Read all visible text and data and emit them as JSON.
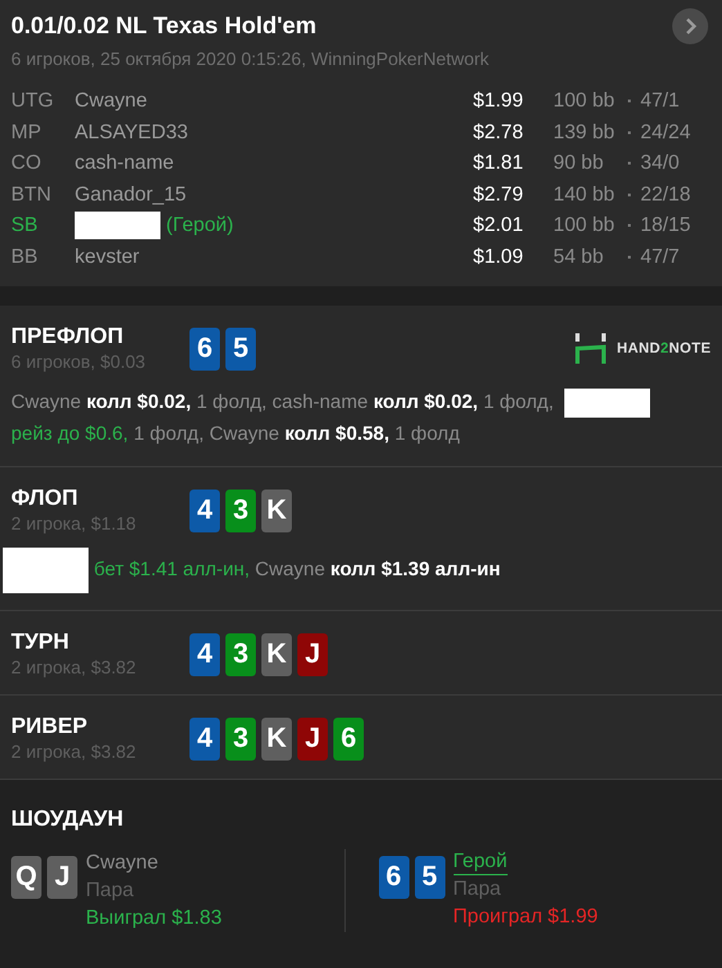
{
  "header": {
    "title": "0.01/0.02 NL Texas Hold'em",
    "subtitle": "6 игроков, 25 октября 2020 0:15:26, WinningPokerNetwork"
  },
  "players": [
    {
      "position": "UTG",
      "name": "Cwayne",
      "hero": false,
      "stack": "$1.99",
      "bb": "100 bb",
      "stats": "47/1"
    },
    {
      "position": "MP",
      "name": "ALSAYED33",
      "hero": false,
      "stack": "$2.78",
      "bb": "139 bb",
      "stats": "24/24"
    },
    {
      "position": "CO",
      "name": "cash-name",
      "hero": false,
      "stack": "$1.81",
      "bb": "90 bb",
      "stats": "34/0"
    },
    {
      "position": "BTN",
      "name": "Ganador_15",
      "hero": false,
      "stack": "$2.79",
      "bb": "140 bb",
      "stats": "22/18"
    },
    {
      "position": "SB",
      "name": "(Герой)",
      "hero": true,
      "stack": "$2.01",
      "bb": "100 bb",
      "stats": "18/15"
    },
    {
      "position": "BB",
      "name": "kevster",
      "hero": false,
      "stack": "$1.09",
      "bb": "54 bb",
      "stats": "47/7"
    }
  ],
  "streets": [
    {
      "title": "ПРЕФЛОП",
      "info": "6 игроков, $0.03",
      "logo": {
        "before": "HAND",
        "accent": "2",
        "after": "NOTE"
      },
      "cards": [
        {
          "rank": "6",
          "color": "#0d5aa8"
        },
        {
          "rank": "5",
          "color": "#0d5aa8"
        }
      ],
      "actions": [
        {
          "kind": "plain",
          "text": "Cwayne "
        },
        {
          "kind": "bold",
          "text": "колл $0.02,"
        },
        {
          "kind": "plain",
          "text": " 1 фолд, cash-name "
        },
        {
          "kind": "bold",
          "text": "колл $0.02,"
        },
        {
          "kind": "plain",
          "text": " 1 фолд, "
        },
        {
          "kind": "redacted"
        },
        {
          "kind": "break"
        },
        {
          "kind": "hero",
          "text": "рейз до $0.6,"
        },
        {
          "kind": "plain",
          "text": " 1 фолд, Cwayne "
        },
        {
          "kind": "bold",
          "text": "колл $0.58,"
        },
        {
          "kind": "plain",
          "text": " 1 фолд"
        }
      ]
    },
    {
      "title": "ФЛОП",
      "info": "2 игрока, $1.18",
      "cards": [
        {
          "rank": "4",
          "color": "#0d5aa8"
        },
        {
          "rank": "3",
          "color": "#088f1b"
        },
        {
          "rank": "K",
          "color": "#5f5f5f"
        }
      ],
      "actions": [
        {
          "kind": "redacted"
        },
        {
          "kind": "hero",
          "text": " бет $1.41 алл-ин,"
        },
        {
          "kind": "plain",
          "text": " Cwayne "
        },
        {
          "kind": "bold",
          "text": "колл $1.39 алл-ин"
        }
      ]
    },
    {
      "title": "ТУРН",
      "info": "2 игрока, $3.82",
      "cards": [
        {
          "rank": "4",
          "color": "#0d5aa8"
        },
        {
          "rank": "3",
          "color": "#088f1b"
        },
        {
          "rank": "K",
          "color": "#5f5f5f"
        },
        {
          "rank": "J",
          "color": "#8f0606"
        }
      ]
    },
    {
      "title": "РИВЕР",
      "info": "2 игрока, $3.82",
      "cards": [
        {
          "rank": "4",
          "color": "#0d5aa8"
        },
        {
          "rank": "3",
          "color": "#088f1b"
        },
        {
          "rank": "K",
          "color": "#5f5f5f"
        },
        {
          "rank": "J",
          "color": "#8f0606"
        },
        {
          "rank": "6",
          "color": "#088f1b"
        }
      ]
    }
  ],
  "showdown": {
    "title": "ШОУДАУН",
    "hands": [
      {
        "cards": [
          {
            "rank": "Q",
            "color": "#5f5f5f"
          },
          {
            "rank": "J",
            "color": "#5f5f5f"
          }
        ],
        "name": "Cwayne",
        "hero": false,
        "combo": "Пара",
        "result": "Выиграл $1.83",
        "won": true
      },
      {
        "cards": [
          {
            "rank": "6",
            "color": "#0d5aa8"
          },
          {
            "rank": "5",
            "color": "#0d5aa8"
          }
        ],
        "name": "Герой",
        "hero": true,
        "combo": "Пара",
        "result": "Проиграл $1.99",
        "won": false
      }
    ]
  }
}
